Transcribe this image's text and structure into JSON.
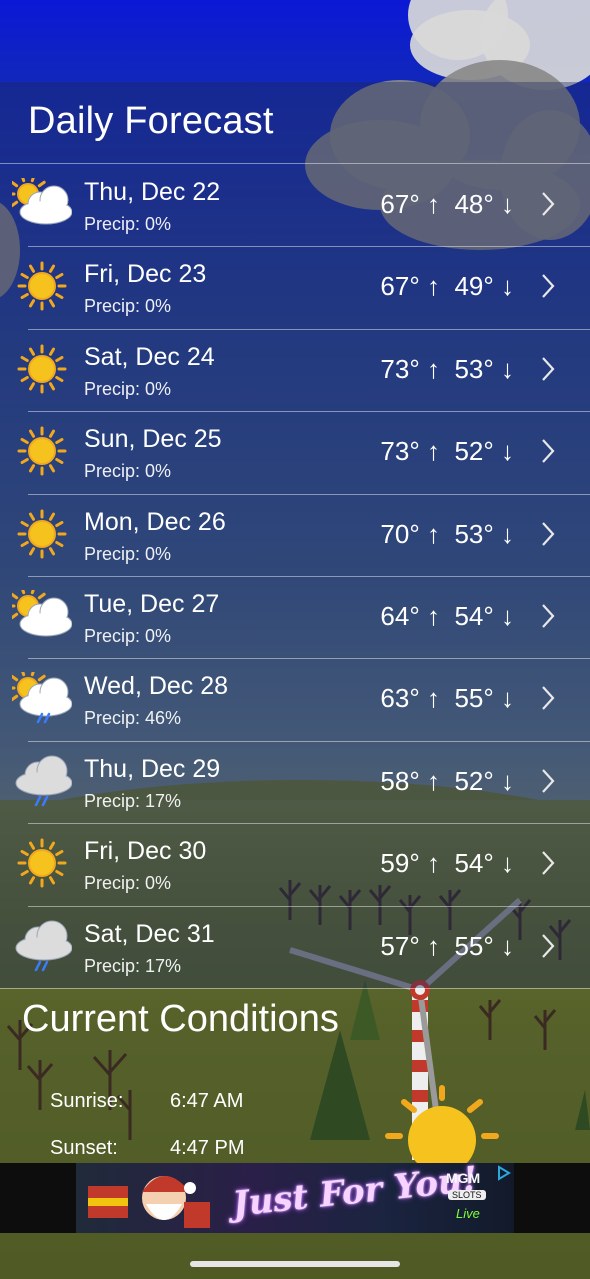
{
  "header": {
    "title": "Daily Forecast"
  },
  "forecast": [
    {
      "day": "Thu, Dec 22",
      "precip": "Precip: 0%",
      "high": "67°",
      "low": "48°",
      "icon": "partly-cloudy-icon"
    },
    {
      "day": "Fri, Dec 23",
      "precip": "Precip: 0%",
      "high": "67°",
      "low": "49°",
      "icon": "sunny-icon"
    },
    {
      "day": "Sat, Dec 24",
      "precip": "Precip: 0%",
      "high": "73°",
      "low": "53°",
      "icon": "sunny-icon"
    },
    {
      "day": "Sun, Dec 25",
      "precip": "Precip: 0%",
      "high": "73°",
      "low": "52°",
      "icon": "sunny-icon"
    },
    {
      "day": "Mon, Dec 26",
      "precip": "Precip: 0%",
      "high": "70°",
      "low": "53°",
      "icon": "sunny-icon"
    },
    {
      "day": "Tue, Dec 27",
      "precip": "Precip: 0%",
      "high": "64°",
      "low": "54°",
      "icon": "partly-cloudy-icon"
    },
    {
      "day": "Wed, Dec 28",
      "precip": "Precip: 46%",
      "high": "63°",
      "low": "55°",
      "icon": "partly-cloudy-rain-icon"
    },
    {
      "day": "Thu, Dec 29",
      "precip": "Precip: 17%",
      "high": "58°",
      "low": "52°",
      "icon": "cloud-rain-icon"
    },
    {
      "day": "Fri, Dec 30",
      "precip": "Precip: 0%",
      "high": "59°",
      "low": "54°",
      "icon": "sunny-icon"
    },
    {
      "day": "Sat, Dec 31",
      "precip": "Precip: 17%",
      "high": "57°",
      "low": "55°",
      "icon": "cloud-rain-icon"
    }
  ],
  "arrows": {
    "up": "↑",
    "down": "↓"
  },
  "current": {
    "title": "Current Conditions",
    "sunrise_label": "Sunrise:",
    "sunrise_value": "6:47 AM",
    "sunset_label": "Sunset:",
    "sunset_value": "4:47 PM"
  },
  "ad": {
    "text": "Just For You!",
    "brand": "MGM",
    "brand_sub": "SLOTS",
    "brand_live": "Live"
  },
  "colors": {
    "sun": "#f6c21d",
    "sun_ray": "#f2a81d",
    "cloud": "#ffffff",
    "rain": "#3a7cff"
  }
}
